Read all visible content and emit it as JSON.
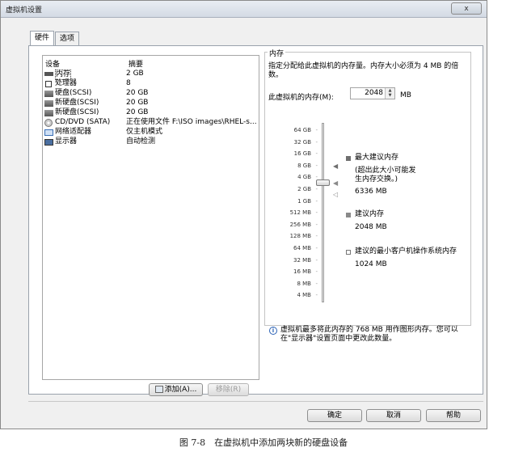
{
  "window": {
    "title": "虚拟机设置",
    "close_label": "x"
  },
  "tabs": [
    {
      "label": "硬件",
      "active": true
    },
    {
      "label": "选项",
      "active": false
    }
  ],
  "device_list": {
    "headers": {
      "device": "设备",
      "summary": "摘要"
    },
    "rows": [
      {
        "icon": "memory-icon",
        "device": "内存",
        "summary": "2 GB",
        "selected": true
      },
      {
        "icon": "processor-icon",
        "device": "处理器",
        "summary": "8"
      },
      {
        "icon": "hard-disk-icon",
        "device": "硬盘(SCSI)",
        "summary": "20 GB"
      },
      {
        "icon": "hard-disk-icon",
        "device": "新硬盘(SCSI)",
        "summary": "20 GB"
      },
      {
        "icon": "hard-disk-icon",
        "device": "新硬盘(SCSI)",
        "summary": "20 GB"
      },
      {
        "icon": "cd-dvd-icon",
        "device": "CD/DVD (SATA)",
        "summary": "正在使用文件 F:\\ISO images\\RHEL-s..."
      },
      {
        "icon": "network-adapter-icon",
        "device": "网络适配器",
        "summary": "仅主机模式"
      },
      {
        "icon": "display-icon",
        "device": "显示器",
        "summary": "自动检测"
      }
    ],
    "add_button": "添加(A)...",
    "remove_button": "移除(R)"
  },
  "memory": {
    "group_label": "内存",
    "description": "指定分配给此虚拟机的内存量。内存大小必须为 4 MB 的倍数。",
    "field_label": "此虚拟机的内存(M):",
    "value": "2048",
    "unit": "MB",
    "scale": [
      "64 GB",
      "32 GB",
      "16 GB",
      "8 GB",
      "4 GB",
      "2 GB",
      "1 GB",
      "512 MB",
      "256 MB",
      "128 MB",
      "64 MB",
      "32 MB",
      "16 MB",
      "8 MB",
      "4 MB"
    ],
    "slider_value": "2 GB",
    "legend": {
      "max": {
        "label": "最大建议内存",
        "note": "(超出此大小可能发生内存交换。)",
        "value": "6336 MB"
      },
      "recommended": {
        "label": "建议内存",
        "value": "2048 MB"
      },
      "min": {
        "label": "建议的最小客户机操作系统内存",
        "value": "1024 MB"
      }
    },
    "info": "虚拟机最多将此内存的 768 MB 用作图形内存。您可以在\"显示器\"设置页面中更改此数量。"
  },
  "footer": {
    "ok": "确定",
    "cancel": "取消",
    "help": "帮助"
  },
  "caption": "图 7-8　在虚拟机中添加两块新的硬盘设备",
  "colors": {
    "max_marker": "#6f6f6f",
    "recommended_marker": "#8a8a8a",
    "min_marker": "#ffffff"
  }
}
